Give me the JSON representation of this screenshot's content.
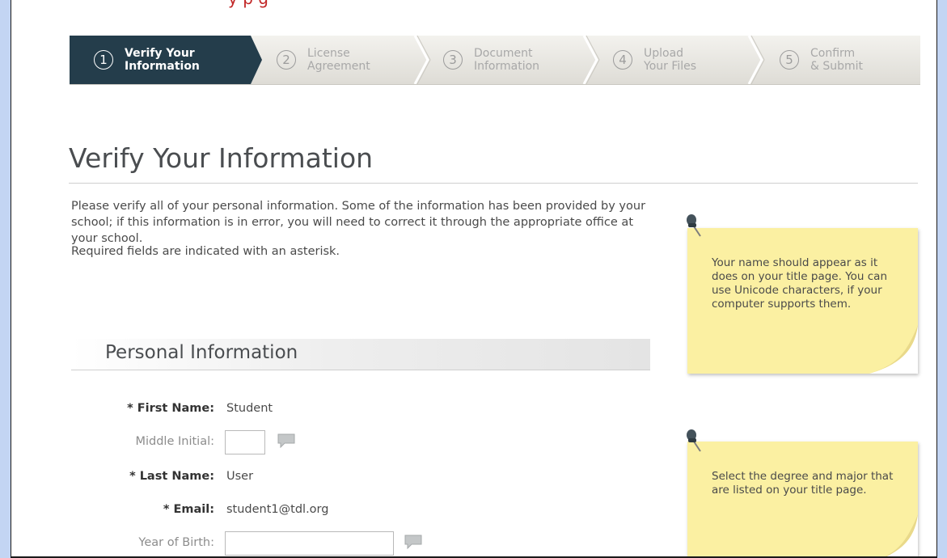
{
  "header": {
    "top_clip_text": "y   p   g"
  },
  "wizard": {
    "steps": [
      {
        "number": "1",
        "label": "Verify Your\nInformation",
        "active": true
      },
      {
        "number": "2",
        "label": "License\nAgreement",
        "active": false
      },
      {
        "number": "3",
        "label": "Document\nInformation",
        "active": false
      },
      {
        "number": "4",
        "label": "Upload\nYour Files",
        "active": false
      },
      {
        "number": "5",
        "label": "Confirm\n& Submit",
        "active": false
      }
    ]
  },
  "page": {
    "title": "Verify Your Information",
    "intro": "Please verify all of your personal information. Some of the information has been provided by your school; if this information is in error, you will need to correct it through the appropriate office at your school.",
    "required_note": "Required fields are indicated with an asterisk."
  },
  "section": {
    "title": "Personal Information"
  },
  "form": {
    "first_name": {
      "label": "* First Name:",
      "value": "Student"
    },
    "middle_initial": {
      "label": "Middle Initial:",
      "value": ""
    },
    "last_name": {
      "label": "* Last Name:",
      "value": "User"
    },
    "email": {
      "label": "* Email:",
      "value": "student1@tdl.org"
    },
    "year_of_birth": {
      "label": "Year of Birth:",
      "value": ""
    }
  },
  "notes": {
    "name_note": "Your name should appear as it does on your title page. You can use Unicode characters, if your computer supports them.",
    "degree_note": "Select the degree and major that are listed on your title page."
  },
  "colors": {
    "active_step": "#243d4b",
    "sticky_note": "#fbf0a2",
    "page_background": "#c3d5f3"
  }
}
